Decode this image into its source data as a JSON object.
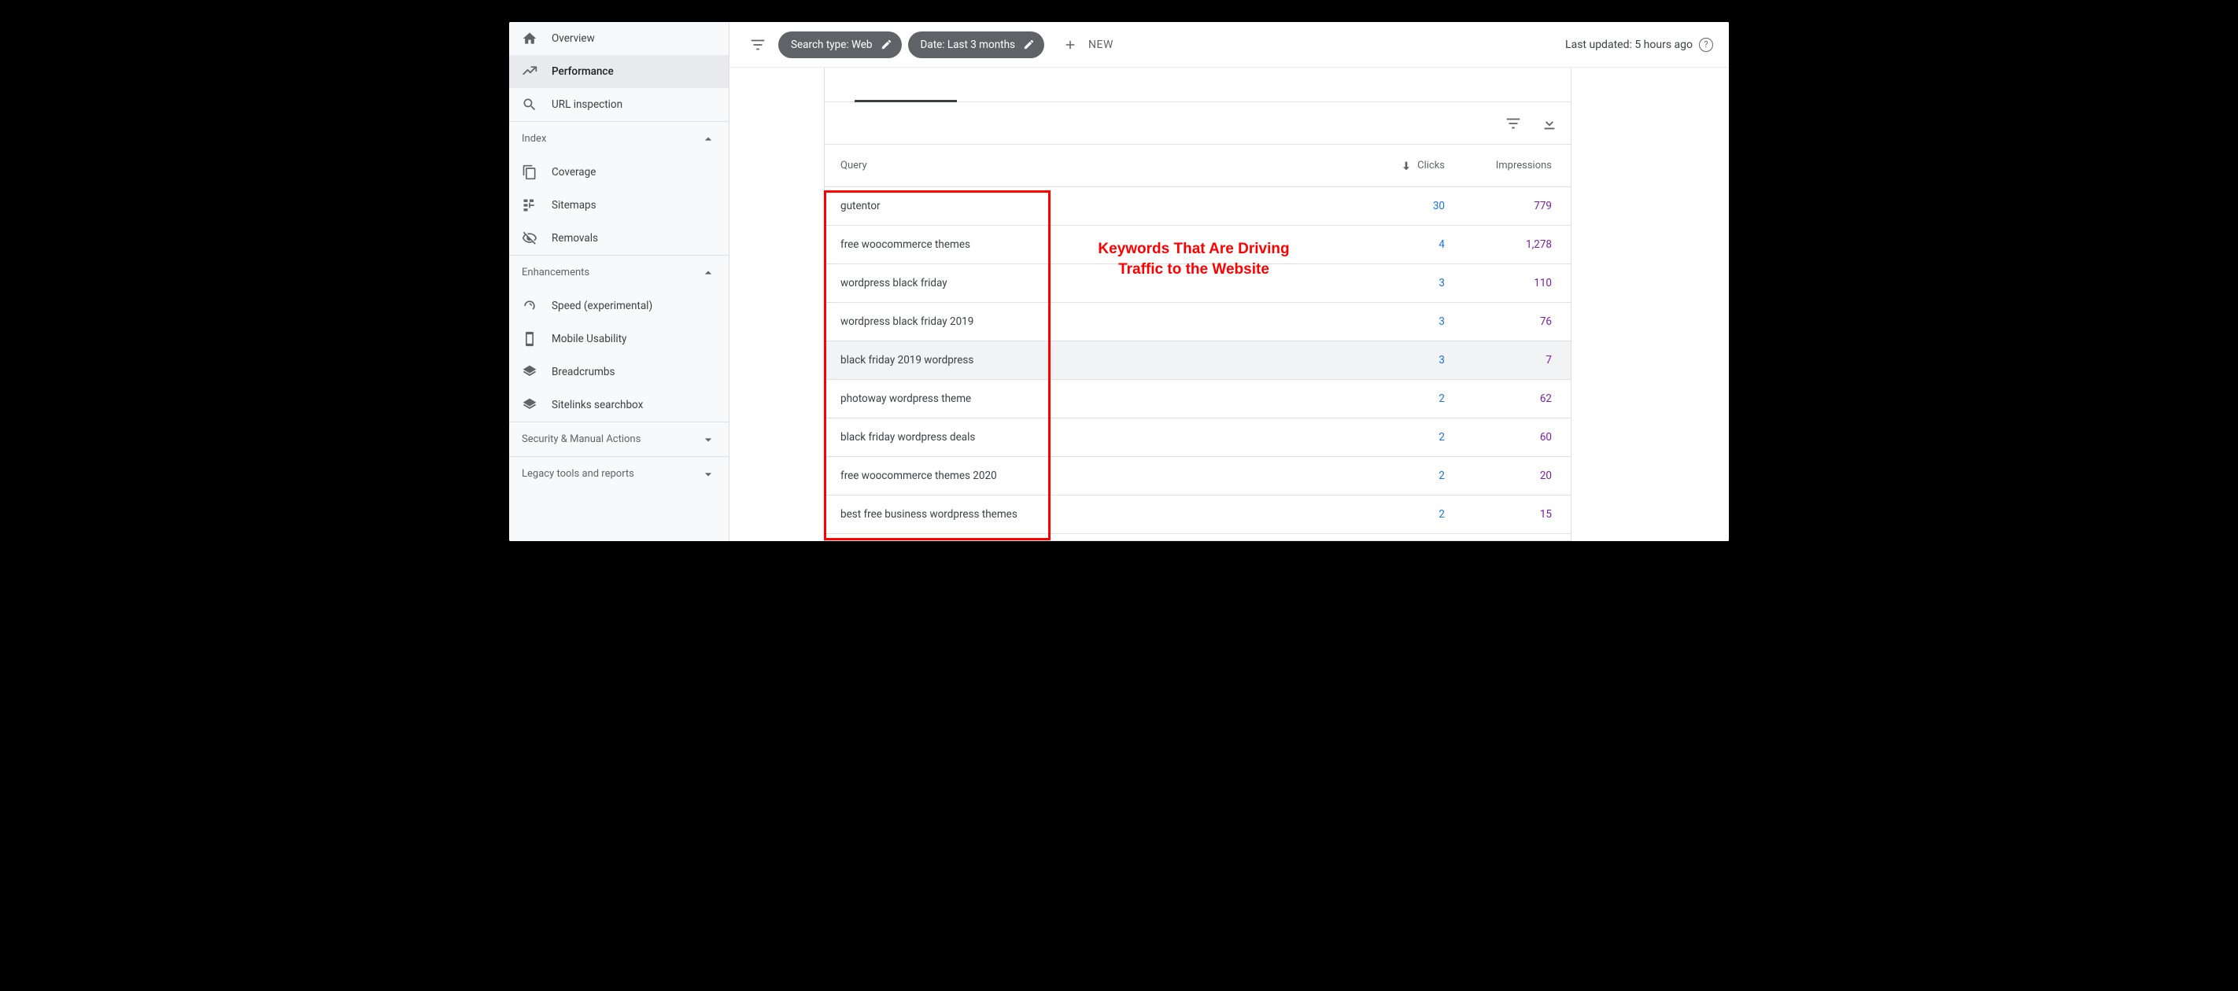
{
  "sidebar": {
    "main": [
      {
        "label": "Overview",
        "icon": "home"
      },
      {
        "label": "Performance",
        "icon": "trend"
      },
      {
        "label": "URL inspection",
        "icon": "search"
      }
    ],
    "index": {
      "title": "Index",
      "items": [
        {
          "label": "Coverage",
          "icon": "copy"
        },
        {
          "label": "Sitemaps",
          "icon": "sitemap"
        },
        {
          "label": "Removals",
          "icon": "hide"
        }
      ]
    },
    "enhancements": {
      "title": "Enhancements",
      "items": [
        {
          "label": "Speed (experimental)",
          "icon": "speed"
        },
        {
          "label": "Mobile Usability",
          "icon": "mobile"
        },
        {
          "label": "Breadcrumbs",
          "icon": "layers"
        },
        {
          "label": "Sitelinks searchbox",
          "icon": "layers"
        }
      ]
    },
    "security_title": "Security & Manual Actions",
    "legacy_title": "Legacy tools and reports"
  },
  "topbar": {
    "chip_search_type": "Search type: Web",
    "chip_date": "Date: Last 3 months",
    "new_label": "NEW",
    "updated_label": "Last updated: 5 hours ago"
  },
  "table": {
    "headers": {
      "query": "Query",
      "clicks": "Clicks",
      "impressions": "Impressions"
    },
    "rows": [
      {
        "query": "gutentor",
        "clicks": "30",
        "impressions": "779"
      },
      {
        "query": "free woocommerce themes",
        "clicks": "4",
        "impressions": "1,278"
      },
      {
        "query": "wordpress black friday",
        "clicks": "3",
        "impressions": "110"
      },
      {
        "query": "wordpress black friday 2019",
        "clicks": "3",
        "impressions": "76"
      },
      {
        "query": "black friday 2019 wordpress",
        "clicks": "3",
        "impressions": "7",
        "highlighted": true
      },
      {
        "query": "photoway wordpress theme",
        "clicks": "2",
        "impressions": "62"
      },
      {
        "query": "black friday wordpress deals",
        "clicks": "2",
        "impressions": "60"
      },
      {
        "query": "free woocommerce themes 2020",
        "clicks": "2",
        "impressions": "20"
      },
      {
        "query": "best free business wordpress themes",
        "clicks": "2",
        "impressions": "15"
      }
    ]
  },
  "annotation": {
    "text": "Keywords That Are Driving\nTraffic to the Website"
  }
}
